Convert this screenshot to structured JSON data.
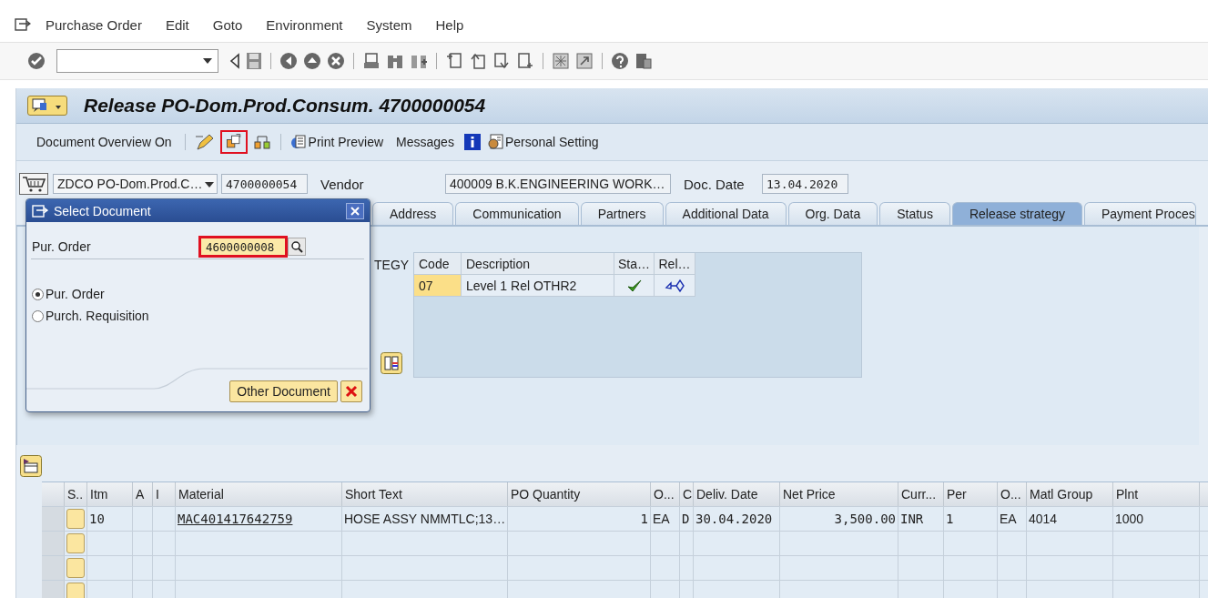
{
  "menu_bar": [
    {
      "label": "Purchase Order"
    },
    {
      "label": "Edit"
    },
    {
      "label": "Goto"
    },
    {
      "label": "Environment"
    },
    {
      "label": "System"
    },
    {
      "label": "Help"
    }
  ],
  "title": "Release PO-Dom.Prod.Consum. 4700000054",
  "app_toolbar": {
    "overview": "Document Overview On",
    "print_preview": "Print Preview",
    "messages": "Messages",
    "personal_setting": "Personal Setting",
    "switch_highlighted": true
  },
  "header": {
    "doc_type": "ZDCO PO-Dom.Prod.C…",
    "doc_number": "4700000054",
    "vendor_label": "Vendor",
    "vendor": "400009 B.K.ENGINEERING WORK…",
    "doc_date_label": "Doc. Date",
    "doc_date": "13.04.2020"
  },
  "tabs": [
    {
      "label": "Address",
      "selected": false
    },
    {
      "label": "Communication",
      "selected": false
    },
    {
      "label": "Partners",
      "selected": false
    },
    {
      "label": "Additional Data",
      "selected": false
    },
    {
      "label": "Org. Data",
      "selected": false
    },
    {
      "label": "Status",
      "selected": false
    },
    {
      "label": "Release strategy",
      "selected": true
    },
    {
      "label": "Payment Proces",
      "selected": false
    }
  ],
  "release_strategy": {
    "label": "TEGY",
    "columns": [
      "Code",
      "Description",
      "Sta…",
      "Rel…"
    ],
    "rows": [
      {
        "code": "07",
        "description": "Level 1 Rel OTHR2",
        "released": true
      }
    ]
  },
  "items": {
    "columns": [
      "S..",
      "Itm",
      "A",
      "I",
      "Material",
      "Short Text",
      "PO Quantity",
      "O...",
      "C",
      "Deliv. Date",
      "Net Price",
      "Curr...",
      "Per",
      "O...",
      "Matl Group",
      "Plnt"
    ],
    "rows": [
      {
        "cells": [
          "",
          "10",
          "",
          "",
          "MAC401417642759",
          "HOSE ASSY NMMTLC;13…",
          "1",
          "EA",
          "D",
          "30.04.2020",
          "3,500.00",
          "INR",
          "1",
          "EA",
          "4014",
          "1000"
        ]
      }
    ]
  },
  "dialog": {
    "title": "Select Document",
    "field_label": "Pur. Order",
    "field_value": "4600000008",
    "field_highlighted": true,
    "options": [
      {
        "label": "Pur. Order",
        "selected": true
      },
      {
        "label": "Purch. Requisition",
        "selected": false
      }
    ],
    "button": "Other Document"
  }
}
